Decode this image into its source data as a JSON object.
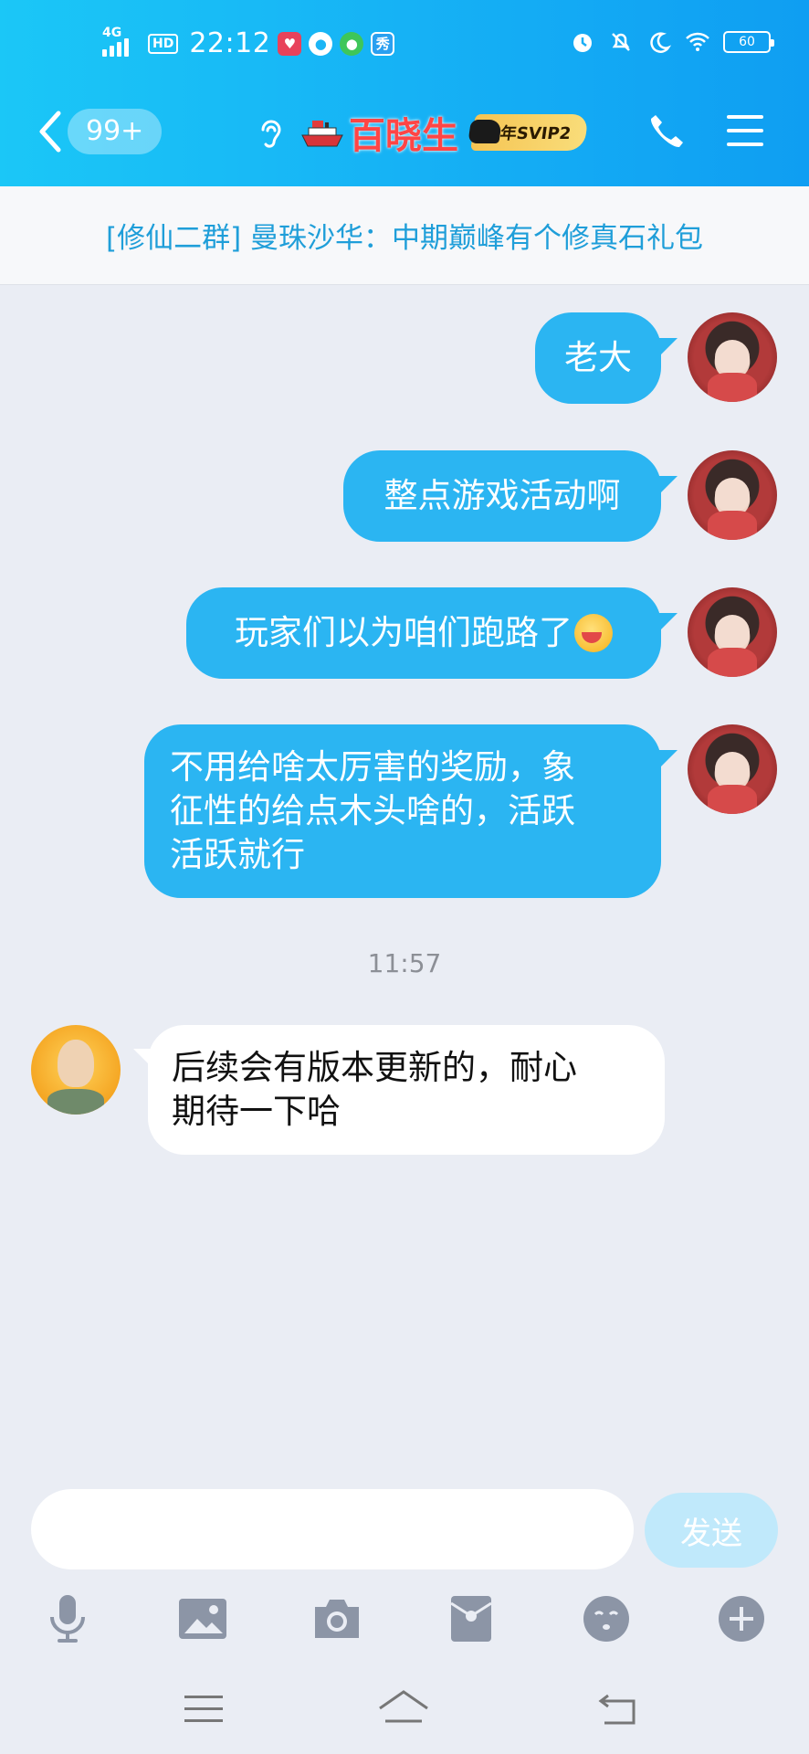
{
  "status_bar": {
    "network": "4G",
    "hd": "HD",
    "time": "22:12",
    "app_icons": [
      "music-app-icon",
      "voice-app-icon",
      "chat-app-icon",
      "show-app-icon"
    ],
    "show_app_label": "秀",
    "battery": "60"
  },
  "header": {
    "unread_count": "99+",
    "title": "百晓生",
    "vip_label": "年SVIP2"
  },
  "notice": {
    "text": "[修仙二群] 曼珠沙华：中期巅峰有个修真石礼包"
  },
  "messages": [
    {
      "side": "self",
      "text": "老大"
    },
    {
      "side": "self",
      "text": "整点游戏活动啊"
    },
    {
      "side": "self",
      "text": "玩家们以为咱们跑路了"
    },
    {
      "side": "self",
      "lines": [
        "不用给啥太厉害的奖励，象",
        "征性的给点木头啥的，活跃",
        "活跃就行"
      ]
    },
    {
      "side": "other",
      "lines": [
        "后续会有版本更新的，耐心",
        "期待一下哈"
      ]
    }
  ],
  "timestamp": "11:57",
  "composer": {
    "placeholder": "",
    "send_label": "发送"
  },
  "colors": {
    "header_gradient_start": "#1bc7f7",
    "header_gradient_end": "#0f9ef2",
    "self_bubble": "#2bb5f2",
    "other_bubble": "#ffffff",
    "notice_text": "#1f9ed9",
    "title_text": "#ff4545",
    "background": "#eaedf4"
  }
}
